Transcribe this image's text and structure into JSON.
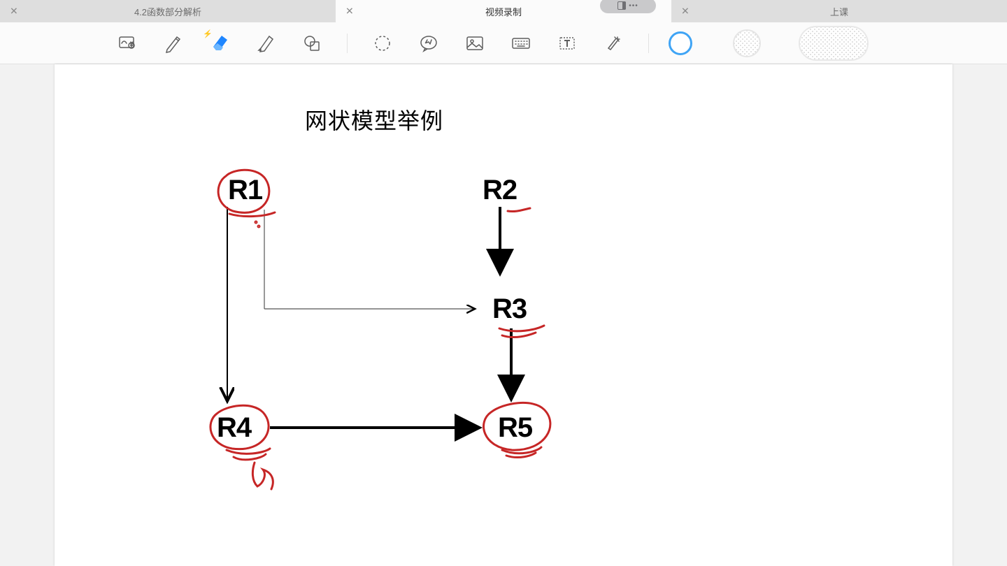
{
  "tabs": [
    {
      "label": "4.2函数部分解析"
    },
    {
      "label": "视频录制"
    },
    {
      "label": "上课"
    }
  ],
  "toolbar": {
    "tools": [
      "zoom-drawing-icon",
      "pen-icon",
      "eraser-icon",
      "highlighter-icon",
      "shapes-icon",
      "lasso-icon",
      "sticker-icon",
      "image-icon",
      "keyboard-icon",
      "text-icon",
      "laser-icon"
    ],
    "swatches": [
      "accent-ring",
      "hatch-circle",
      "hatch-pill"
    ]
  },
  "canvas": {
    "title": "网状模型举例",
    "nodes": {
      "r1": "R1",
      "r2": "R2",
      "r3": "R3",
      "r4": "R4",
      "r5": "R5"
    }
  },
  "colors": {
    "accent": "#3fa4f5",
    "annotation": "#c62626"
  }
}
